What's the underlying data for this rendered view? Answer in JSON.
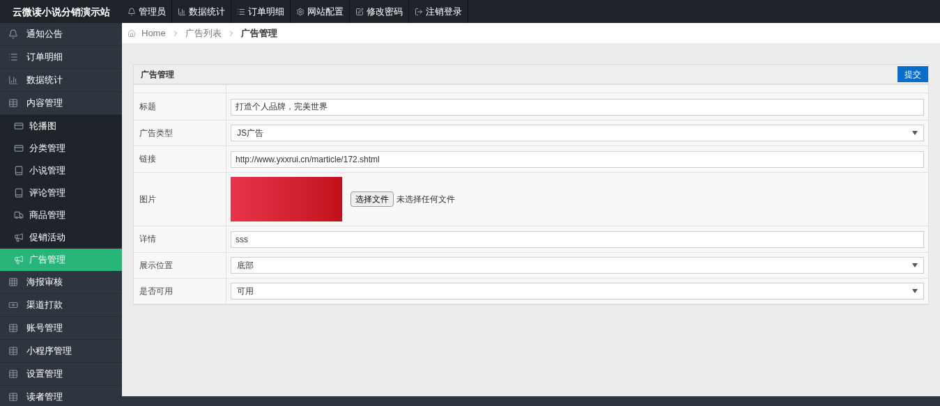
{
  "brand": "云微读小说分销演示站",
  "top_nav": [
    {
      "label": "管理员"
    },
    {
      "label": "数据统计"
    },
    {
      "label": "订单明细"
    },
    {
      "label": "网站配置"
    },
    {
      "label": "修改密码"
    },
    {
      "label": "注销登录"
    }
  ],
  "sidebar": {
    "items": [
      {
        "label": "通知公告",
        "selected": false
      },
      {
        "label": "订单明细",
        "selected": false
      },
      {
        "label": "数据统计",
        "selected": false
      },
      {
        "label": "内容管理",
        "selected": false,
        "expanded": true,
        "children": [
          {
            "label": "轮播图",
            "selected": false
          },
          {
            "label": "分类管理",
            "selected": false
          },
          {
            "label": "小说管理",
            "selected": false
          },
          {
            "label": "评论管理",
            "selected": false
          },
          {
            "label": "商品管理",
            "selected": false
          },
          {
            "label": "促销活动",
            "selected": false
          },
          {
            "label": "广告管理",
            "selected": true
          }
        ]
      },
      {
        "label": "海报审核",
        "selected": false
      },
      {
        "label": "渠道打款",
        "selected": false
      },
      {
        "label": "账号管理",
        "selected": false
      },
      {
        "label": "小程序管理",
        "selected": false
      },
      {
        "label": "设置管理",
        "selected": false
      },
      {
        "label": "读者管理",
        "selected": false
      }
    ]
  },
  "breadcrumb": [
    {
      "label": "Home",
      "current": false
    },
    {
      "label": "广告列表",
      "current": false
    },
    {
      "label": "广告管理",
      "current": true
    }
  ],
  "panel": {
    "title": "广告管理",
    "submit": "提交",
    "rows": [
      {
        "kind": "text",
        "label": "标题",
        "value": "打造个人品牌，完美世界"
      },
      {
        "kind": "select",
        "label": "广告类型",
        "value": "JS广告"
      },
      {
        "kind": "text",
        "label": "链接",
        "value": "http://www.yxxrui.cn/marticle/172.shtml"
      },
      {
        "kind": "image",
        "label": "图片",
        "button": "选择文件",
        "status": "未选择任何文件"
      },
      {
        "kind": "text",
        "label": "详情",
        "value": "sss"
      },
      {
        "kind": "select",
        "label": "展示位置",
        "value": "底部"
      },
      {
        "kind": "select",
        "label": "是否可用",
        "value": "可用"
      }
    ]
  }
}
